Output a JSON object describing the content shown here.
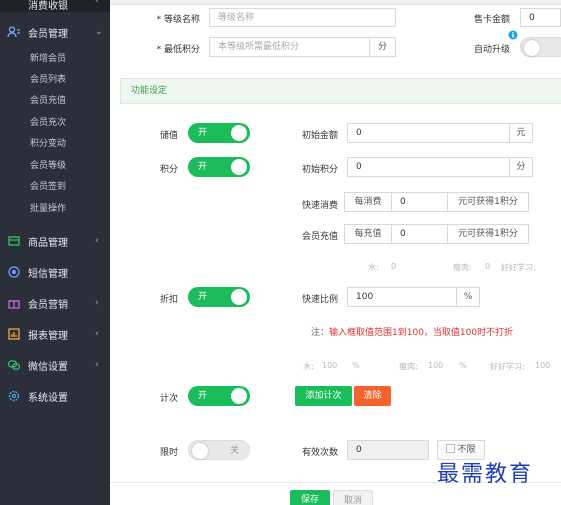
{
  "sidebar": {
    "top_label": "消费收银",
    "member_mgmt": "会员管理",
    "sub_items": [
      "新增会员",
      "会员列表",
      "会员充值",
      "会员充次",
      "积分变动",
      "会员等级",
      "会员签到",
      "批量操作"
    ],
    "items": [
      {
        "label": "商品管理",
        "icon": "box-icon"
      },
      {
        "label": "短信管理",
        "icon": "sms-icon"
      },
      {
        "label": "会员营销",
        "icon": "gift-icon"
      },
      {
        "label": "报表管理",
        "icon": "chart-icon"
      },
      {
        "label": "微信设置",
        "icon": "wechat-icon"
      },
      {
        "label": "系统设置",
        "icon": "gear-icon"
      }
    ]
  },
  "form": {
    "level_name_label": "* 等级名称",
    "level_name_placeholder": "等级名称",
    "min_points_label": "* 最低积分",
    "min_points_placeholder": "本等级所需最低积分",
    "min_points_unit": "分",
    "card_amount_label": "售卡金额",
    "card_amount_value": "0",
    "auto_upgrade_label": "自动升级"
  },
  "section_title": "功能设定",
  "stored_value": {
    "label": "储值",
    "toggle": "开",
    "init_amount_label": "初始金额",
    "init_amount_value": "0",
    "init_amount_unit": "元"
  },
  "points": {
    "label": "积分",
    "toggle": "开",
    "init_points_label": "初始积分",
    "init_points_value": "0",
    "init_points_unit": "分",
    "quick_label": "快速消费",
    "quick_prefix": "每消费",
    "quick_value": "0",
    "quick_suffix": "元可获得1积分",
    "recharge_label": "会员充值",
    "recharge_prefix": "每充值",
    "recharge_value": "0",
    "recharge_suffix": "元可获得1积分",
    "faint": [
      "水:",
      "0",
      "瘦肉:",
      "0",
      "好好学习:"
    ]
  },
  "discount": {
    "label": "折扣",
    "toggle": "开",
    "ratio_label": "快速比例",
    "ratio_value": "100",
    "ratio_unit": "%",
    "note_prefix": "注：",
    "note": "输入框取值范围1到100，当取值100时不打折",
    "faint": [
      "水:",
      "100",
      "%",
      "瘦肉:",
      "100",
      "%",
      "好好学习:",
      "100"
    ]
  },
  "count": {
    "label": "计次",
    "toggle": "开",
    "add_btn": "添加计次",
    "clear_btn": "清除"
  },
  "limit": {
    "label": "限时",
    "toggle": "关",
    "valid_label": "有效次数",
    "valid_value": "0",
    "no_limit": "不限"
  },
  "actions": {
    "save": "保存",
    "cancel": "取消"
  },
  "watermark": "最需教育",
  "colors": {
    "primary": "#1bbd5b",
    "danger": "#f5642f",
    "sidebar": "#2b2f3a"
  }
}
